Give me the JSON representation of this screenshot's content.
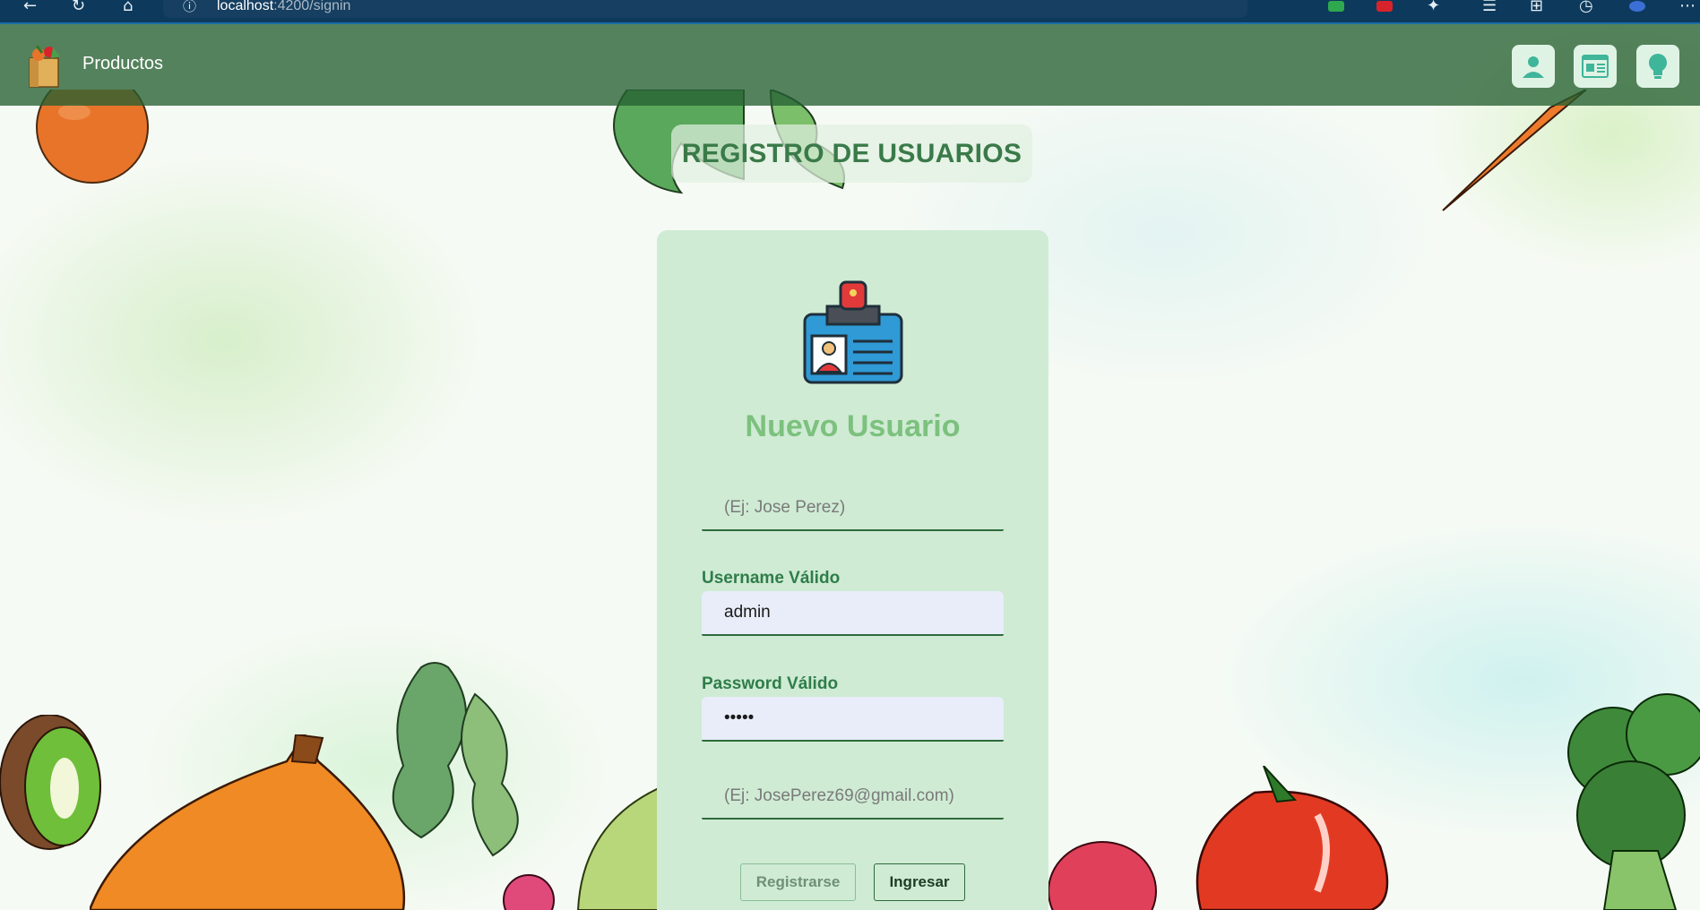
{
  "browser": {
    "url_host": "localhost",
    "url_path": ":4200/signin"
  },
  "navbar": {
    "brand": "Productos",
    "buttons": [
      "user-icon",
      "dashboard-icon",
      "lightbulb-icon"
    ]
  },
  "page": {
    "title": "REGISTRO DE USUARIOS"
  },
  "form": {
    "heading": "Nuevo Usuario",
    "name_placeholder": "(Ej: Jose Perez)",
    "username_label": "Username Válido",
    "username_value": "admin",
    "password_label": "Password Válido",
    "password_value": "•••••",
    "email_placeholder": "(Ej: JosePerez69@gmail.com)",
    "register_button": "Registrarse",
    "login_button": "Ingresar"
  },
  "colors": {
    "navbar": "#266032",
    "card": "#cfebd4",
    "accent": "#2f7d4a",
    "heading": "#7cc17e"
  }
}
